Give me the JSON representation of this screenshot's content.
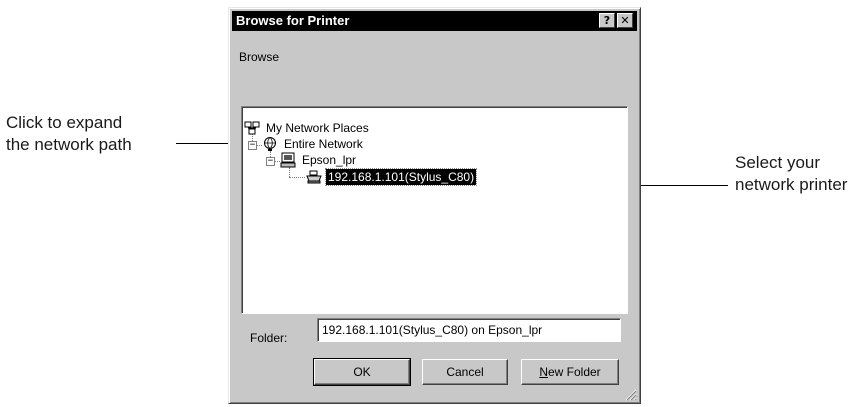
{
  "annotations": {
    "left_callout_line1": "Click to expand",
    "left_callout_line2": "the network path",
    "right_callout_line1": "Select your",
    "right_callout_line2": "network printer"
  },
  "dialog": {
    "title": "Browse for Printer",
    "help_button": "?",
    "close_button": "✕",
    "browse_label": "Browse",
    "tree": {
      "root": {
        "label": "My Network Places",
        "icon": "network-places-icon"
      },
      "entire_network": {
        "label": "Entire Network",
        "icon": "globe-icon",
        "expander": "−"
      },
      "server": {
        "label": "Epson_lpr",
        "icon": "computer-icon",
        "expander": "−"
      },
      "printer": {
        "label": "192.168.1.101(Stylus_C80)",
        "icon": "printer-icon",
        "selected": true
      }
    },
    "folder_label": "Folder:",
    "folder_value": "192.168.1.101(Stylus_C80) on Epson_lpr",
    "buttons": {
      "ok": "OK",
      "cancel": "Cancel",
      "new_folder_mnemonic": "N",
      "new_folder_rest": "ew Folder"
    }
  },
  "colors": {
    "dialog_face": "#c8c8c8",
    "titlebar": "#000000",
    "selection": "#000000"
  }
}
